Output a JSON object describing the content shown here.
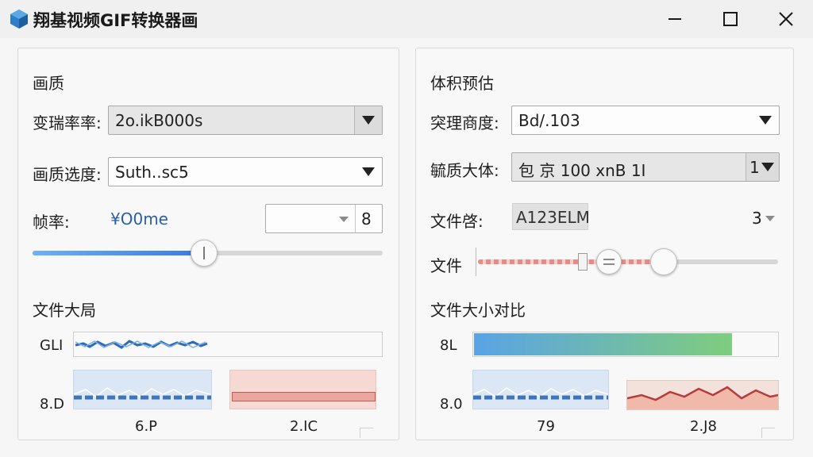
{
  "window": {
    "title": "翔基视频GIF转换器画",
    "minimize_icon": "minimize-icon",
    "maximize_icon": "maximize-icon",
    "close_icon": "close-icon"
  },
  "left": {
    "section_title": "画质",
    "rate_label": "变瑞率率:",
    "rate_value": "2o.ikB000s",
    "quality_label": "画质选度:",
    "quality_value": "Suth..sc5",
    "fps_label": "帧率:",
    "fps_readout": "¥O0me",
    "fps_spin_value": "8",
    "slider_level": 0.49,
    "size_title": "文件大局",
    "row1_tag": "GLI",
    "row2_tag": "8.D",
    "cap1": "6.P",
    "cap2": "2.IC"
  },
  "right": {
    "section_title": "体积预估",
    "res_label": "突理商度:",
    "res_value": "Bd/.103",
    "body_label": "毓质大体:",
    "body_value": "包 京 100 xnB 1I",
    "body_arrow_prefix": "1",
    "file_label": "文件啓:",
    "file_value": "A123ELM",
    "file_count": "3",
    "file_slider_label": "文件",
    "file_slider_level": 0.62,
    "compare_title": "文件大小对比",
    "row1_tag": "8L",
    "row2_tag": "8.0",
    "bar_level": 0.85,
    "cap1": "79",
    "cap2": "2.J8"
  },
  "colors": {
    "accent_blue": "#3b7bd8",
    "accent_green": "#7ac97a",
    "accent_red": "#d35a5a"
  }
}
